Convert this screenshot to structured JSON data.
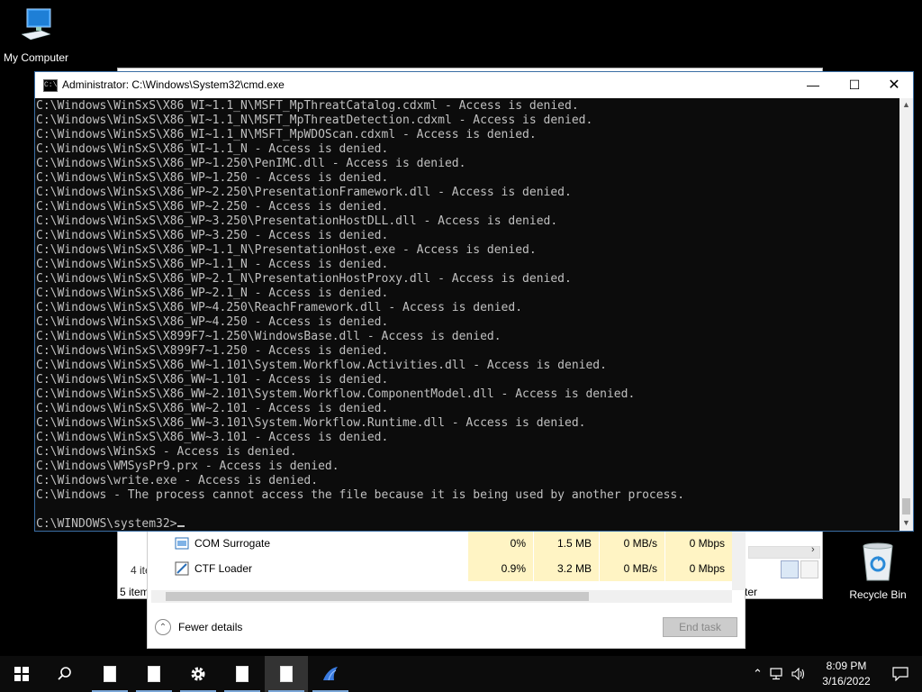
{
  "desktop": {
    "my_computer_label": "My Computer",
    "recycle_bin_label": "Recycle Bin"
  },
  "explorer": {
    "status_item_count": "4 ite",
    "status_items": "5 item",
    "status_right": "ter"
  },
  "taskmgr": {
    "rows": [
      {
        "name": "COM Surrogate",
        "cpu": "0%",
        "memory": "1.5 MB",
        "disk": "0 MB/s",
        "network": "0 Mbps",
        "icon": "com-surrogate-icon"
      },
      {
        "name": "CTF Loader",
        "cpu": "0.9%",
        "memory": "3.2 MB",
        "disk": "0 MB/s",
        "network": "0 Mbps",
        "icon": "ctf-loader-icon"
      }
    ],
    "fewer_details_label": "Fewer details",
    "end_task_label": "End task"
  },
  "cmd": {
    "title": "Administrator: C:\\Windows\\System32\\cmd.exe",
    "icon_glyph": "C:\\",
    "lines": [
      "C:\\Windows\\WinSxS\\X86_WI~1.1_N\\MSFT_MpThreatCatalog.cdxml - Access is denied.",
      "C:\\Windows\\WinSxS\\X86_WI~1.1_N\\MSFT_MpThreatDetection.cdxml - Access is denied.",
      "C:\\Windows\\WinSxS\\X86_WI~1.1_N\\MSFT_MpWDOScan.cdxml - Access is denied.",
      "C:\\Windows\\WinSxS\\X86_WI~1.1_N - Access is denied.",
      "C:\\Windows\\WinSxS\\X86_WP~1.250\\PenIMC.dll - Access is denied.",
      "C:\\Windows\\WinSxS\\X86_WP~1.250 - Access is denied.",
      "C:\\Windows\\WinSxS\\X86_WP~2.250\\PresentationFramework.dll - Access is denied.",
      "C:\\Windows\\WinSxS\\X86_WP~2.250 - Access is denied.",
      "C:\\Windows\\WinSxS\\X86_WP~3.250\\PresentationHostDLL.dll - Access is denied.",
      "C:\\Windows\\WinSxS\\X86_WP~3.250 - Access is denied.",
      "C:\\Windows\\WinSxS\\X86_WP~1.1_N\\PresentationHost.exe - Access is denied.",
      "C:\\Windows\\WinSxS\\X86_WP~1.1_N - Access is denied.",
      "C:\\Windows\\WinSxS\\X86_WP~2.1_N\\PresentationHostProxy.dll - Access is denied.",
      "C:\\Windows\\WinSxS\\X86_WP~2.1_N - Access is denied.",
      "C:\\Windows\\WinSxS\\X86_WP~4.250\\ReachFramework.dll - Access is denied.",
      "C:\\Windows\\WinSxS\\X86_WP~4.250 - Access is denied.",
      "C:\\Windows\\WinSxS\\X899F7~1.250\\WindowsBase.dll - Access is denied.",
      "C:\\Windows\\WinSxS\\X899F7~1.250 - Access is denied.",
      "C:\\Windows\\WinSxS\\X86_WW~1.101\\System.Workflow.Activities.dll - Access is denied.",
      "C:\\Windows\\WinSxS\\X86_WW~1.101 - Access is denied.",
      "C:\\Windows\\WinSxS\\X86_WW~2.101\\System.Workflow.ComponentModel.dll - Access is denied.",
      "C:\\Windows\\WinSxS\\X86_WW~2.101 - Access is denied.",
      "C:\\Windows\\WinSxS\\X86_WW~3.101\\System.Workflow.Runtime.dll - Access is denied.",
      "C:\\Windows\\WinSxS\\X86_WW~3.101 - Access is denied.",
      "C:\\Windows\\WinSxS - Access is denied.",
      "C:\\Windows\\WMSysPr9.prx - Access is denied.",
      "C:\\Windows\\write.exe - Access is denied.",
      "C:\\Windows - The process cannot access the file because it is being used by another process.",
      ""
    ],
    "prompt": "C:\\WINDOWS\\system32>"
  },
  "taskbar": {
    "items": [
      {
        "name": "start-button",
        "icon": "windows-logo-icon"
      },
      {
        "name": "search-button",
        "icon": "search-icon"
      },
      {
        "name": "taskbar-notepad-1",
        "icon": "document-icon"
      },
      {
        "name": "taskbar-notepad-2",
        "icon": "document-icon"
      },
      {
        "name": "taskbar-settings",
        "icon": "gear-icon"
      },
      {
        "name": "taskbar-notepad-3",
        "icon": "document-icon"
      },
      {
        "name": "taskbar-notepad-4",
        "icon": "document-icon"
      },
      {
        "name": "taskbar-app-bird",
        "icon": "bird-icon"
      }
    ],
    "clock_time": "8:09 PM",
    "clock_date": "3/16/2022"
  },
  "colors": {
    "cmd_bg": "#0c0c0c",
    "cmd_text": "#c0c0c0",
    "taskmgr_highlight": "#fff4c4",
    "taskbar_accent": "#7aa7d8"
  }
}
